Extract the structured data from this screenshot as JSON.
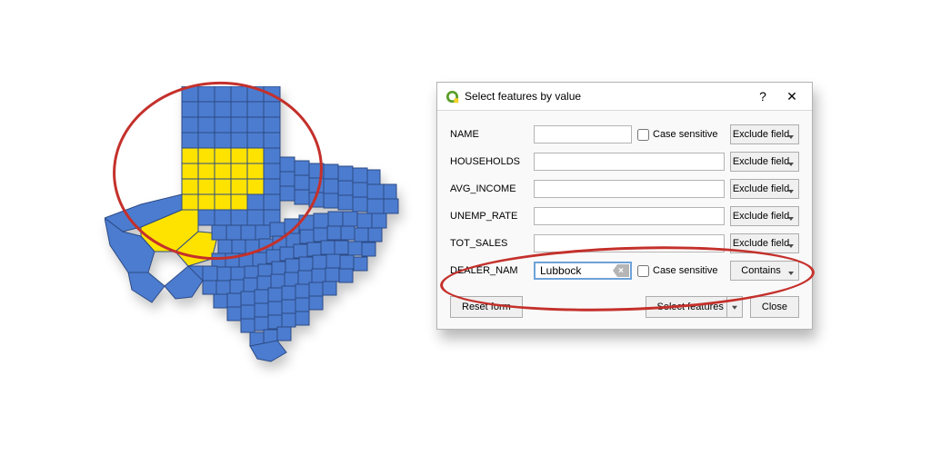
{
  "dialog": {
    "title": "Select features by value",
    "fields": [
      {
        "label": "NAME",
        "value": "",
        "has_case": true,
        "case_label": "Case sensitive",
        "op": "Exclude field"
      },
      {
        "label": "HOUSEHOLDS",
        "value": "",
        "has_case": false,
        "op": "Exclude field"
      },
      {
        "label": "AVG_INCOME",
        "value": "",
        "has_case": false,
        "op": "Exclude field"
      },
      {
        "label": "UNEMP_RATE",
        "value": "",
        "has_case": false,
        "op": "Exclude field"
      },
      {
        "label": "TOT_SALES",
        "value": "",
        "has_case": false,
        "op": "Exclude field"
      },
      {
        "label": "DEALER_NAM",
        "value": "Lubbock",
        "has_case": true,
        "case_label": "Case sensitive",
        "op": "Contains",
        "active": true,
        "clear": true
      }
    ],
    "buttons": {
      "reset": "Reset form",
      "select": "Select features",
      "close": "Close"
    },
    "help_glyph": "?",
    "close_glyph": "✕"
  },
  "map": {
    "default_fill": "#4c7ccf",
    "selected_fill": "#ffe300",
    "stroke": "#2b4a85"
  }
}
